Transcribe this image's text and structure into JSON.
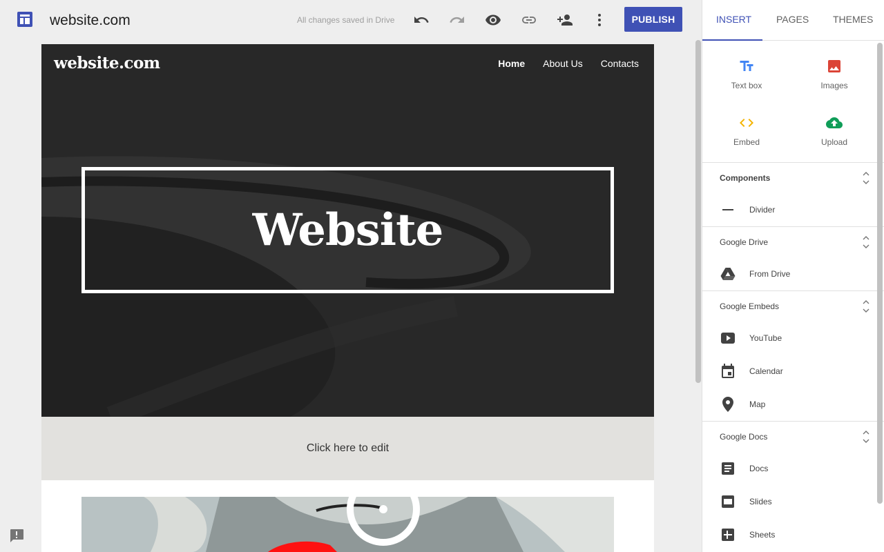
{
  "topbar": {
    "title": "website.com",
    "save_status": "All changes saved in Drive",
    "publish_label": "PUBLISH",
    "icons": [
      "undo-icon",
      "redo-icon",
      "preview-icon",
      "link-icon",
      "share-icon",
      "more-icon"
    ]
  },
  "site": {
    "logo": "website.com",
    "nav": [
      "Home",
      "About Us",
      "Contacts"
    ],
    "active_nav": "Home",
    "hero_title": "Website",
    "edit_prompt": "Click here to edit"
  },
  "panel": {
    "tabs": [
      "INSERT",
      "PAGES",
      "THEMES"
    ],
    "active_tab": "INSERT",
    "insert": {
      "text_box": "Text box",
      "images": "Images",
      "embed": "Embed",
      "upload": "Upload"
    },
    "sections": {
      "components": {
        "title": "Components",
        "items": [
          "Divider"
        ]
      },
      "drive": {
        "title": "Google Drive",
        "items": [
          "From Drive"
        ]
      },
      "embeds": {
        "title": "Google Embeds",
        "items": [
          "YouTube",
          "Calendar",
          "Map"
        ]
      },
      "docs": {
        "title": "Google Docs",
        "items": [
          "Docs",
          "Slides",
          "Sheets"
        ]
      }
    }
  },
  "colors": {
    "accent": "#3f51b5",
    "text_box_icon": "#4285f4",
    "images_icon": "#db4437",
    "embed_icon": "#f4b400",
    "upload_icon": "#0f9d58"
  }
}
